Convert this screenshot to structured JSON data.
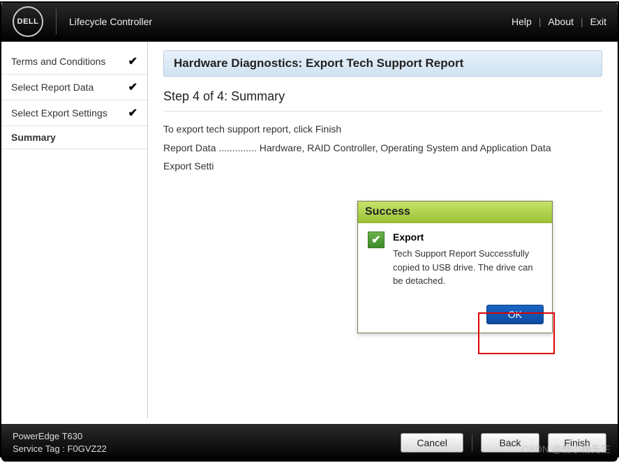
{
  "topbar": {
    "brand": "DELL",
    "title": "Lifecycle Controller",
    "help": "Help",
    "about": "About",
    "exit": "Exit"
  },
  "sidebar": {
    "items": [
      {
        "label": "Terms and Conditions",
        "done": true,
        "active": false
      },
      {
        "label": "Select Report Data",
        "done": true,
        "active": false
      },
      {
        "label": "Select Export Settings",
        "done": true,
        "active": false
      },
      {
        "label": "Summary",
        "done": false,
        "active": true
      }
    ]
  },
  "main": {
    "title": "Hardware Diagnostics: Export Tech Support Report",
    "step_title": "Step 4 of 4: Summary",
    "instruction": "To export tech support report, click Finish",
    "report_data_label": "Report Data",
    "report_data_value": "Hardware, RAID Controller, Operating System and Application Data",
    "export_settings_label": "Export Setti"
  },
  "dialog": {
    "head": "Success",
    "subtitle": "Export",
    "message": "Tech Support Report Successfully copied to USB drive. The drive can be detached.",
    "ok": "OK"
  },
  "footer": {
    "model": "PowerEdge T630",
    "service_tag_label": "Service Tag :",
    "service_tag": "F0GVZ22",
    "cancel": "Cancel",
    "back": "Back",
    "finish": "Finish"
  },
  "watermark": "CSDN @杨小杨先生"
}
